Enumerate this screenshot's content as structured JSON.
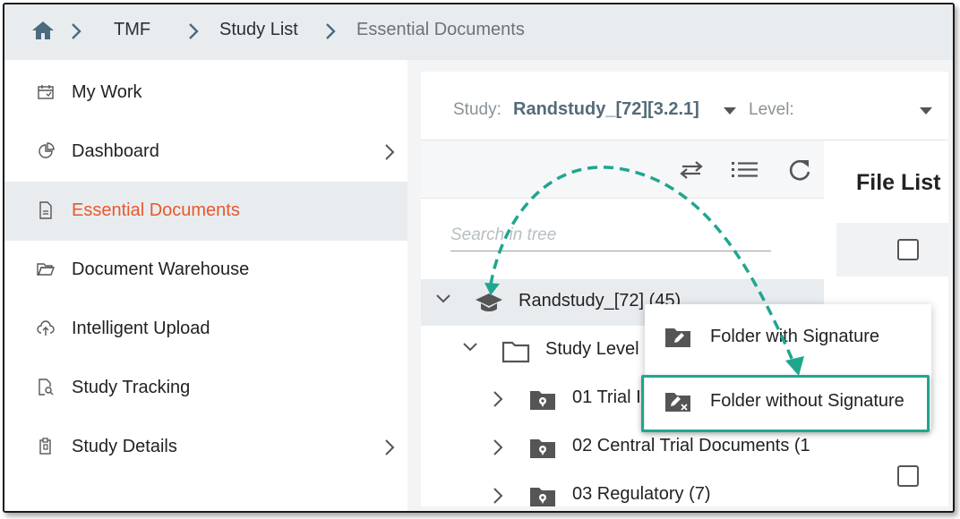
{
  "breadcrumb": {
    "items": [
      "TMF",
      "Study List",
      "Essential Documents"
    ]
  },
  "sidebar": {
    "items": [
      {
        "label": "My Work",
        "icon": "calendar-check-icon"
      },
      {
        "label": "Dashboard",
        "icon": "pie-chart-icon"
      },
      {
        "label": "Essential Documents",
        "icon": "document-icon"
      },
      {
        "label": "Document Warehouse",
        "icon": "folder-open-icon"
      },
      {
        "label": "Intelligent Upload",
        "icon": "cloud-upload-icon"
      },
      {
        "label": "Study Tracking",
        "icon": "document-search-icon"
      },
      {
        "label": "Study Details",
        "icon": "clipboard-copy-icon"
      }
    ],
    "active_color": "#e8582c"
  },
  "study_selector": {
    "label": "Study:",
    "value": "Randstudy_[72][3.2.1]",
    "level_label": "Level:"
  },
  "tree": {
    "search_placeholder": "Search in tree",
    "root_label": "Randstudy_[72] (45)",
    "study_level_label": "Study Level",
    "children": [
      "01 Trial I",
      "02 Central Trial Documents (1",
      "03 Regulatory (7)"
    ]
  },
  "file_list": {
    "title": "File List"
  },
  "context_menu": {
    "items": [
      "Folder with Signature",
      "Folder without Signature"
    ]
  },
  "highlight_color": "#1fa68f"
}
